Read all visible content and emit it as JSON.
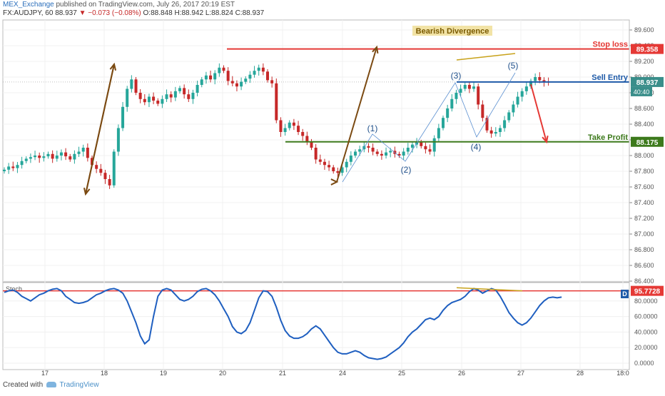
{
  "header": {
    "username": "MEX_Exchange",
    "published_text": "published on TradingView.com, July 26, 2017 20:19 EST",
    "symbol": "FX:AUDJPY, 60",
    "last": "88.937",
    "change": "−0.073 (−0.08%)",
    "ohlc_o": "O:88.848",
    "ohlc_h": "H:88.942",
    "ohlc_l": "L:88.824",
    "ohlc_c": "C:88.937"
  },
  "footer": {
    "created_with": "Created with",
    "brand": "TradingView"
  },
  "colors": {
    "candle_up": "#26a69a",
    "candle_down": "#c62828",
    "stop": "#e53935",
    "entry": "#1e5aa8",
    "target": "#3d7a1c",
    "arrow": "#7b4a12",
    "stoch": "#1f5fc0",
    "divergence": "#c8a21a"
  },
  "chart_data": [
    {
      "type": "candlestick",
      "symbol": "FX:AUDJPY",
      "interval": "60",
      "ylim": [
        87.0,
        89.7
      ],
      "price_ticks": [
        "89.600",
        "89.400",
        "89.200",
        "89.000",
        "88.800",
        "88.600",
        "88.400",
        "88.200",
        "88.000",
        "87.800",
        "87.600",
        "87.400",
        "87.200",
        "87.000",
        "86.800",
        "86.600",
        "86.400"
      ],
      "x_ticks": [
        "17",
        "18",
        "19",
        "20",
        "21",
        "24",
        "25",
        "26",
        "27",
        "28",
        "18:0"
      ],
      "close": [
        87.82,
        87.86,
        87.84,
        87.88,
        87.93,
        87.96,
        87.98,
        88.0,
        87.97,
        87.99,
        88.02,
        87.96,
        88.0,
        88.04,
        87.99,
        87.95,
        88.02,
        88.05,
        88.1,
        87.97,
        87.88,
        87.83,
        87.78,
        87.7,
        87.62,
        88.05,
        88.35,
        88.62,
        88.85,
        88.97,
        88.8,
        88.72,
        88.68,
        88.75,
        88.7,
        88.66,
        88.72,
        88.78,
        88.74,
        88.82,
        88.86,
        88.78,
        88.72,
        88.8,
        88.9,
        88.97,
        89.02,
        88.97,
        89.05,
        89.12,
        89.08,
        88.95,
        88.92,
        88.88,
        88.94,
        88.98,
        89.03,
        89.08,
        89.12,
        89.07,
        88.96,
        88.92,
        88.45,
        88.3,
        88.35,
        88.42,
        88.38,
        88.3,
        88.25,
        88.18,
        88.1,
        87.95,
        87.92,
        87.88,
        87.85,
        87.8,
        87.78,
        87.85,
        87.92,
        88.0,
        88.05,
        88.08,
        88.12,
        88.1,
        88.05,
        88.02,
        88.0,
        88.04,
        88.06,
        88.02,
        88.0,
        88.05,
        88.1,
        88.14,
        88.17,
        88.12,
        88.08,
        88.05,
        88.22,
        88.35,
        88.48,
        88.6,
        88.72,
        88.8,
        88.85,
        88.9,
        88.85,
        88.88,
        88.65,
        88.48,
        88.32,
        88.28,
        88.3,
        88.35,
        88.45,
        88.55,
        88.65,
        88.75,
        88.82,
        88.88,
        88.95,
        89.0,
        88.96,
        88.94,
        88.937
      ],
      "stop_loss": {
        "label": "Stop loss",
        "value": "89.358"
      },
      "sell_entry": {
        "label": "Sell Entry",
        "value": "88.937",
        "countdown": "40:40"
      },
      "take_profit": {
        "label": "Take Profit",
        "value": "88.175"
      },
      "annotations": {
        "title": "Bearish Divergence",
        "waves": [
          "(1)",
          "(2)",
          "(3)",
          "(4)",
          "(5)"
        ]
      }
    },
    {
      "type": "line",
      "series": [
        {
          "name": "Stoch",
          "values": [
            91,
            93,
            94,
            91,
            86,
            83,
            80,
            84,
            88,
            90,
            93,
            95,
            96,
            93,
            86,
            82,
            78,
            77,
            78,
            80,
            84,
            88,
            90,
            93,
            95,
            96,
            94,
            90,
            80,
            66,
            52,
            35,
            25,
            30,
            60,
            86,
            94,
            96,
            94,
            88,
            82,
            80,
            82,
            86,
            92,
            95,
            96,
            93,
            88,
            80,
            70,
            60,
            47,
            40,
            38,
            42,
            52,
            68,
            84,
            93,
            92,
            86,
            72,
            55,
            42,
            35,
            32,
            32,
            34,
            38,
            44,
            48,
            44,
            36,
            28,
            20,
            14,
            12,
            12,
            14,
            16,
            14,
            10,
            7,
            6,
            5,
            6,
            8,
            12,
            16,
            20,
            26,
            34,
            40,
            44,
            50,
            56,
            58,
            56,
            60,
            68,
            74,
            78,
            80,
            82,
            86,
            92,
            96,
            94,
            90,
            93,
            96,
            94,
            86,
            76,
            65,
            58,
            52,
            49,
            52,
            58,
            66,
            74,
            80,
            84,
            85,
            84,
            85
          ]
        }
      ],
      "ylim": [
        0,
        100
      ],
      "y_ticks": [
        "80.0000",
        "60.0000",
        "40.0000",
        "20.0000",
        "0.0000"
      ],
      "last_value": "95.7728",
      "badge": "D"
    }
  ]
}
